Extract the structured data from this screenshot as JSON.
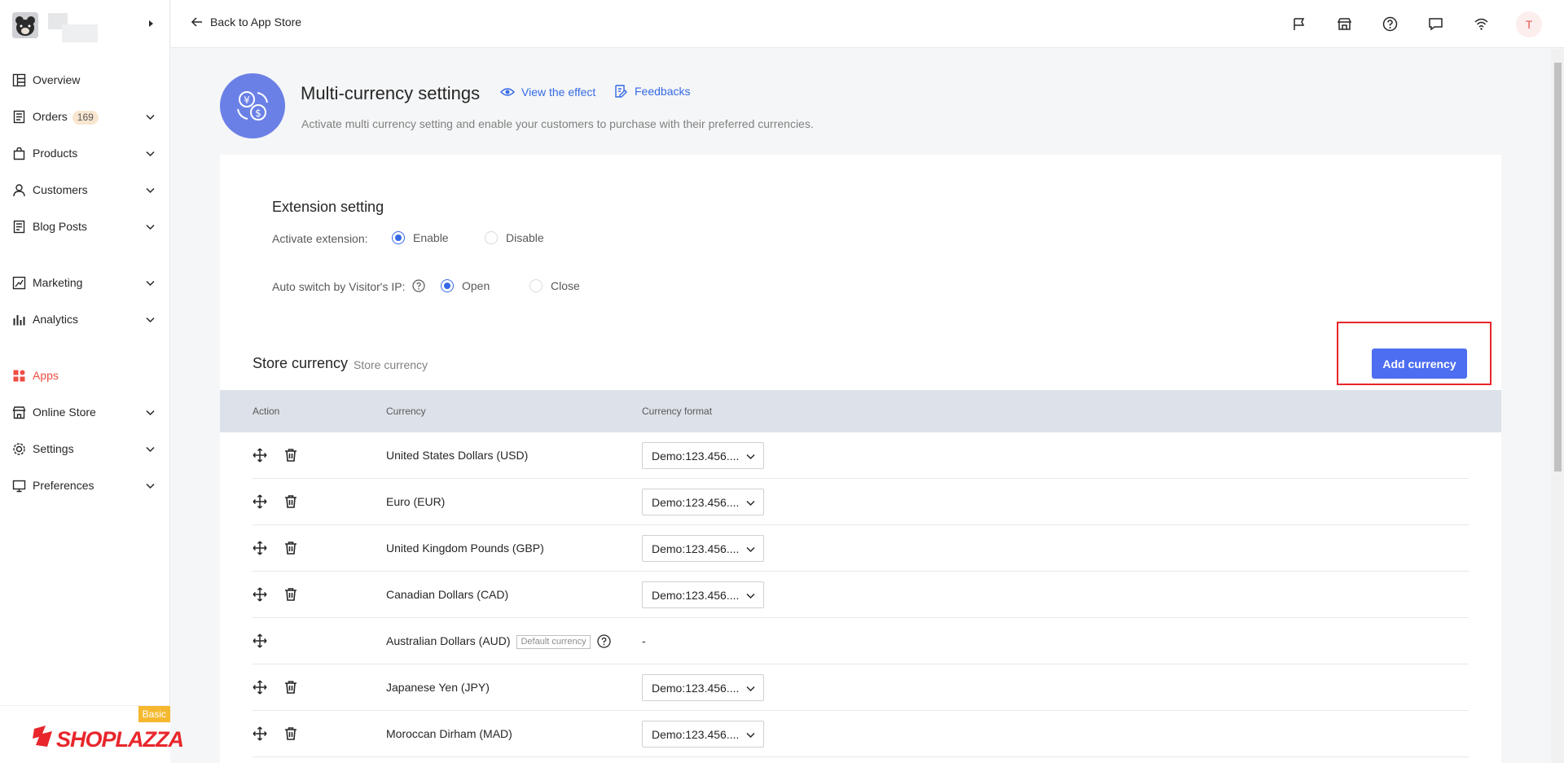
{
  "sidebar": {
    "items": [
      {
        "label": "Overview",
        "icon": "overview-icon",
        "chevron": false
      },
      {
        "label": "Orders",
        "icon": "orders-icon",
        "badge": "169",
        "chevron": true
      },
      {
        "label": "Products",
        "icon": "products-icon",
        "chevron": true
      },
      {
        "label": "Customers",
        "icon": "customers-icon",
        "chevron": true
      },
      {
        "label": "Blog Posts",
        "icon": "blog-icon",
        "chevron": true
      },
      {
        "label": "Marketing",
        "icon": "marketing-icon",
        "chevron": true
      },
      {
        "label": "Analytics",
        "icon": "analytics-icon",
        "chevron": true
      },
      {
        "label": "Apps",
        "icon": "apps-icon",
        "chevron": false,
        "active": true
      },
      {
        "label": "Online Store",
        "icon": "online-store-icon",
        "chevron": true
      },
      {
        "label": "Settings",
        "icon": "settings-icon",
        "chevron": true
      },
      {
        "label": "Preferences",
        "icon": "preferences-icon",
        "chevron": true
      }
    ],
    "brand": "SHOPLAZZA",
    "plan_badge": "Basic"
  },
  "topbar": {
    "back_label": "Back to App Store",
    "user_initial": "T",
    "icons": [
      "flag-icon",
      "store-icon",
      "help-icon",
      "chat-icon",
      "wifi-icon"
    ]
  },
  "header": {
    "title": "Multi-currency settings",
    "view_effect": "View the effect",
    "feedbacks": "Feedbacks",
    "subtitle": "Activate multi currency setting and enable your customers to purchase with their preferred currencies."
  },
  "extension": {
    "title": "Extension setting",
    "activate_label": "Activate extension:",
    "enable_label": "Enable",
    "disable_label": "Disable",
    "autoswitch_label": "Auto switch by Visitor's IP:",
    "open_label": "Open",
    "close_label": "Close"
  },
  "store": {
    "title": "Store currency",
    "subtitle": "Store currency",
    "add_button": "Add currency",
    "columns": [
      "Action",
      "Currency",
      "Currency format"
    ],
    "default_tag": "Default currency",
    "rows": [
      {
        "currency": "United States Dollars (USD)",
        "format": "Demo:123.456....",
        "default": false
      },
      {
        "currency": "Euro (EUR)",
        "format": "Demo:123.456....",
        "default": false
      },
      {
        "currency": "United Kingdom Pounds (GBP)",
        "format": "Demo:123.456....",
        "default": false
      },
      {
        "currency": "Canadian Dollars (CAD)",
        "format": "Demo:123.456....",
        "default": false
      },
      {
        "currency": "Australian Dollars (AUD)",
        "format": "-",
        "default": true
      },
      {
        "currency": "Japanese Yen (JPY)",
        "format": "Demo:123.456....",
        "default": false
      },
      {
        "currency": "Moroccan Dirham (MAD)",
        "format": "Demo:123.456....",
        "default": false
      }
    ]
  },
  "colors": {
    "accent": "#356ae6",
    "button": "#4d6ef0",
    "highlight": "#e8262c",
    "active_nav": "#ee4d43"
  }
}
